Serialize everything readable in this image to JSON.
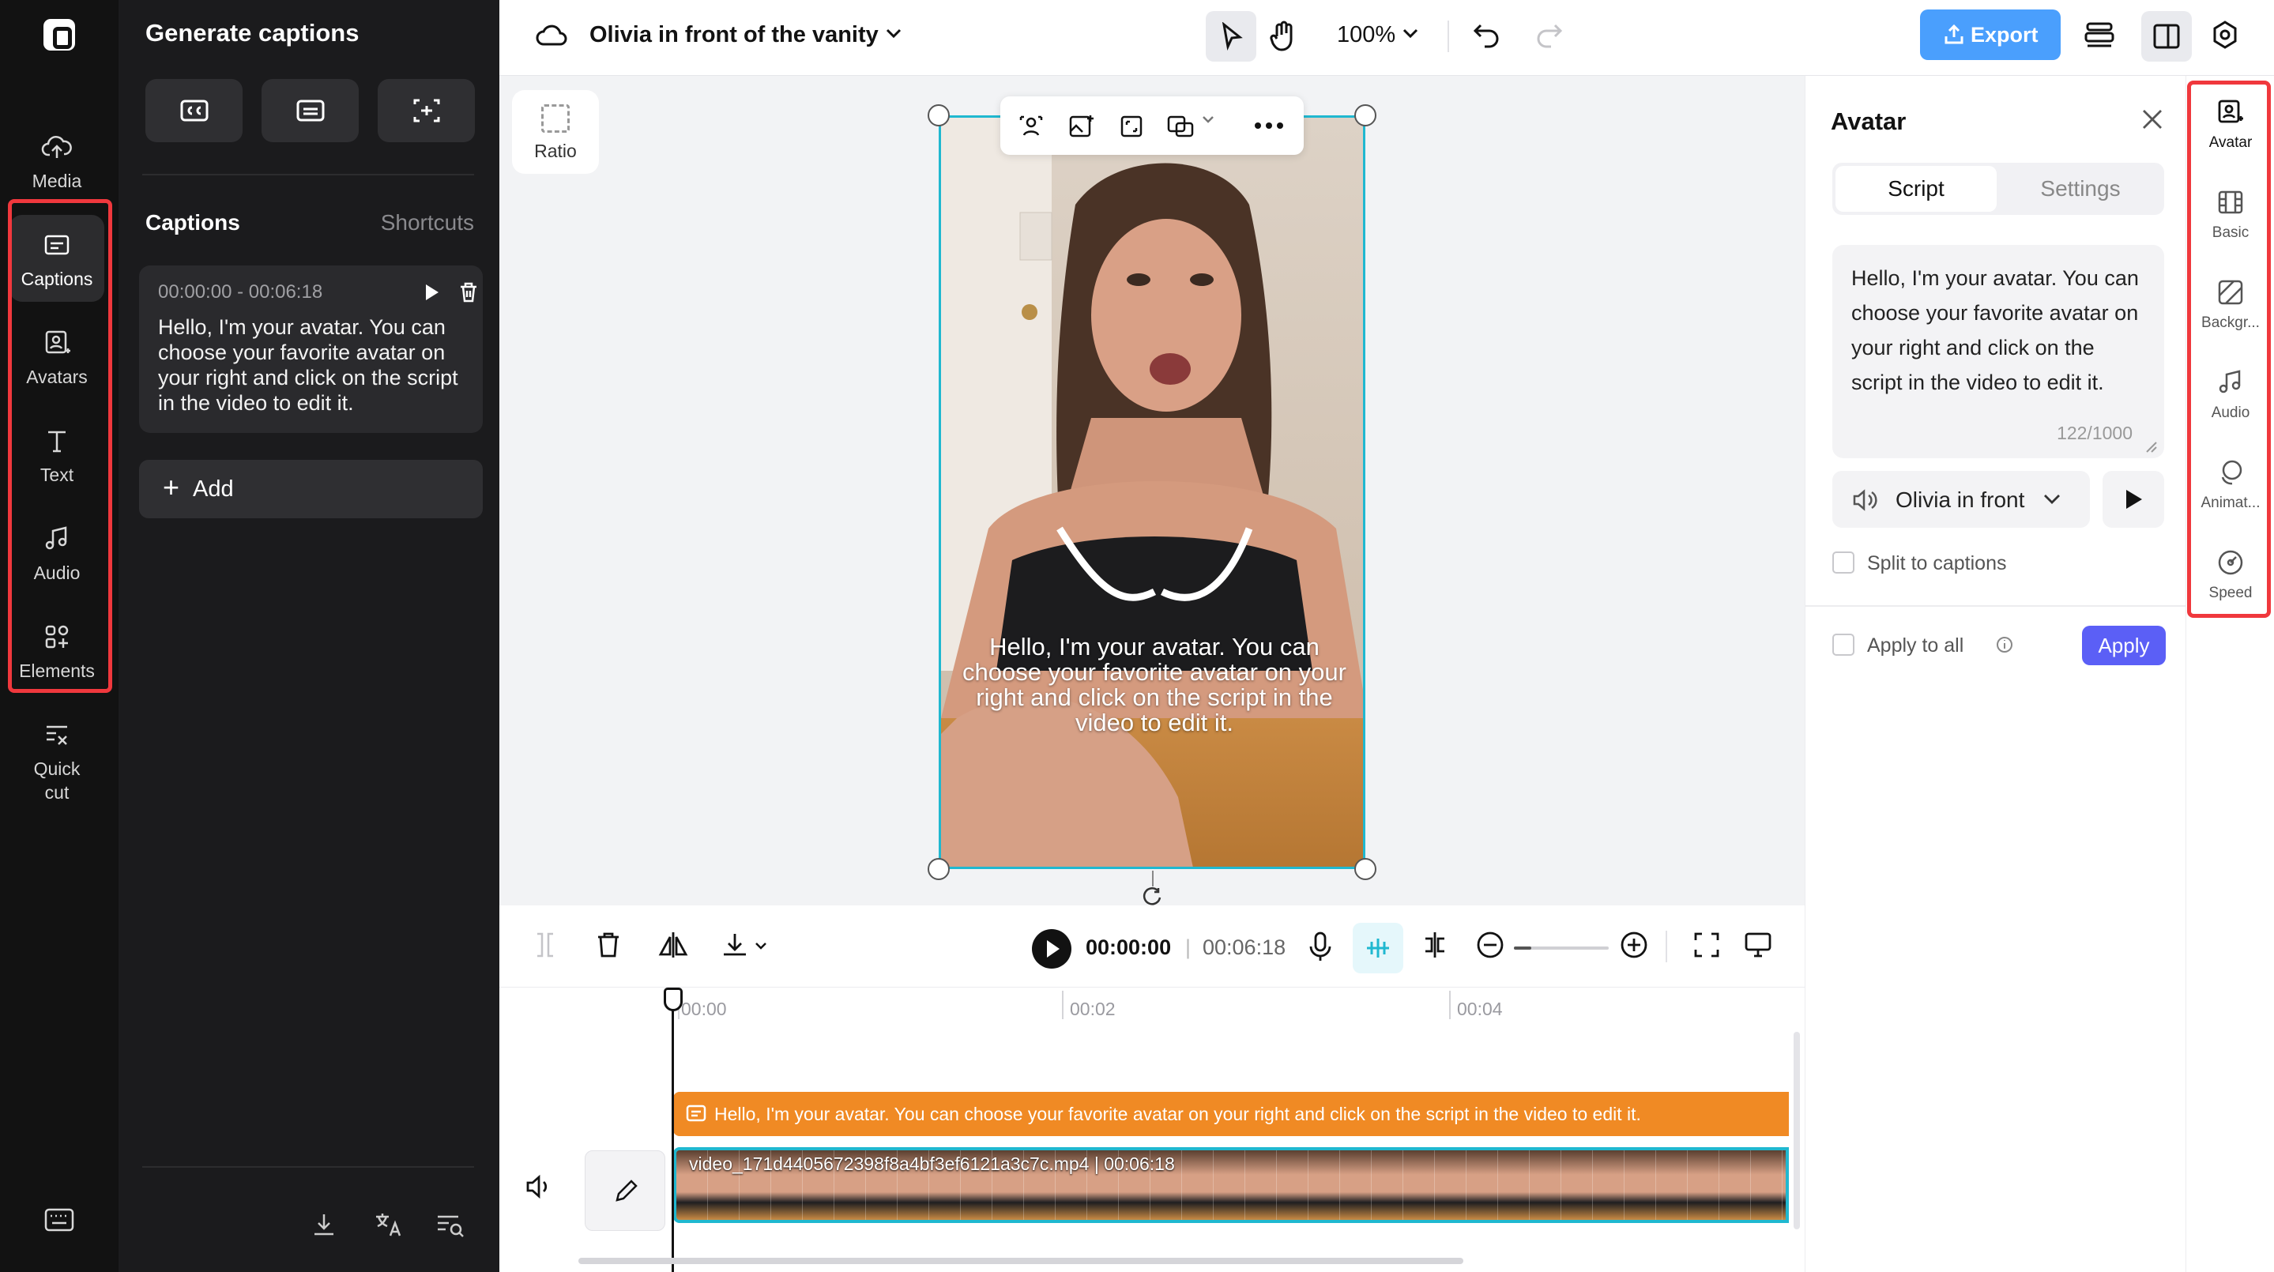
{
  "rail": {
    "items": [
      {
        "label": "Media",
        "icon": "cloud-upload-icon"
      },
      {
        "label": "Captions",
        "icon": "captions-icon"
      },
      {
        "label": "Avatars",
        "icon": "avatar-icon"
      },
      {
        "label": "Text",
        "icon": "text-icon"
      },
      {
        "label": "Audio",
        "icon": "music-note-icon"
      },
      {
        "label": "Elements",
        "icon": "elements-icon"
      },
      {
        "label": "Quick cut",
        "icon": "quick-cut-icon"
      }
    ],
    "active": "Captions"
  },
  "captions_panel": {
    "title": "Generate captions",
    "section_title": "Captions",
    "shortcuts_label": "Shortcuts",
    "caption": {
      "time": "00:00:00 - 00:06:18",
      "text": "Hello, I'm your avatar. You can choose your favorite avatar on your right and click on the script in the video to edit it."
    },
    "add_label": "Add"
  },
  "topbar": {
    "project_title": "Olivia in front of the vanity",
    "zoom": "100%",
    "export_label": "Export"
  },
  "canvas": {
    "ratio_label": "Ratio",
    "overlay_caption": "Hello, I'm your avatar. You can choose your favorite avatar on your right and click on the script in the video to edit it."
  },
  "timeline": {
    "current_time": "00:00:00",
    "separator": "|",
    "total_time": "00:06:18",
    "ruler": [
      "00:00",
      "00:02",
      "00:04"
    ],
    "caption_track_text": "Hello, I'm your avatar. You can choose your favorite avatar on your right and click on the script in the video to edit it.",
    "video_track_label": "video_171d4405672398f8a4bf3ef6121a3c7c.mp4 | 00:06:18"
  },
  "avatar_panel": {
    "title": "Avatar",
    "tabs": [
      "Script",
      "Settings"
    ],
    "active_tab": "Script",
    "script_text": "Hello, I'm your avatar. You can choose your favorite avatar on your right and click on the script in the video to edit it.",
    "char_count": "122/1000",
    "voice": "Olivia in front",
    "split_label": "Split to captions",
    "apply_all_label": "Apply to all",
    "apply_label": "Apply"
  },
  "property_rail": {
    "items": [
      "Avatar",
      "Basic",
      "Backgr...",
      "Audio",
      "Animat...",
      "Speed"
    ],
    "active": "Avatar"
  },
  "colors": {
    "accent_blue": "#4a9ffd",
    "apply_purple": "#5b5ff6",
    "caption_track_orange": "#f08a24",
    "selection_cyan": "#20b8d0",
    "highlight_red": "#f0383d"
  }
}
